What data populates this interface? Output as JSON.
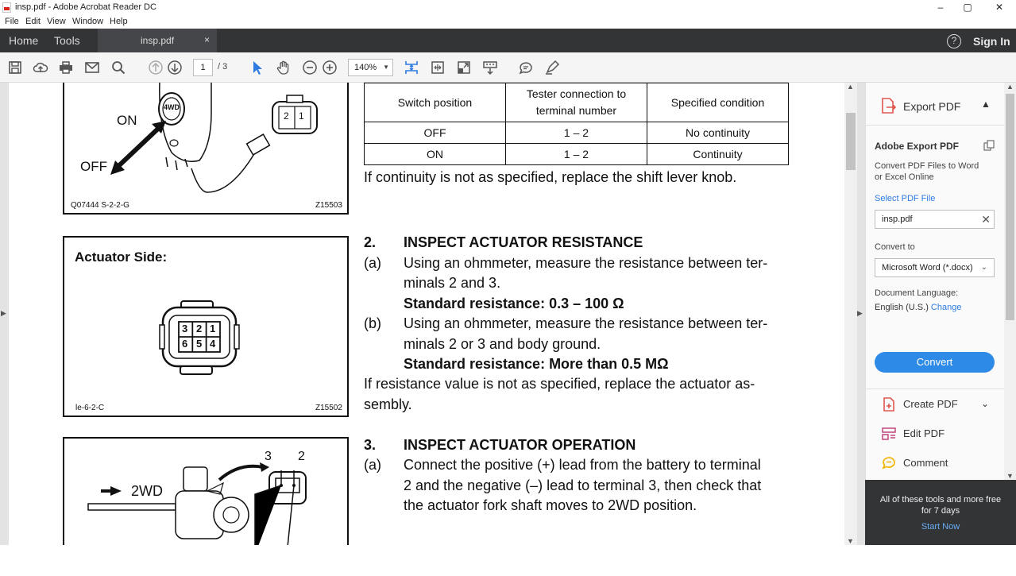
{
  "window": {
    "title": "insp.pdf - Adobe Acrobat Reader DC",
    "minimize": "–",
    "maximize": "▢",
    "close": "✕"
  },
  "menu": [
    "File",
    "Edit",
    "View",
    "Window",
    "Help"
  ],
  "tabs": {
    "home": "Home",
    "tools": "Tools",
    "document": "insp.pdf",
    "close": "×"
  },
  "header": {
    "help_glyph": "?",
    "sign_in": "Sign In"
  },
  "toolbar": {
    "current_page": "1",
    "total_pages": "/ 3",
    "zoom": "140%"
  },
  "document": {
    "table": {
      "headers": [
        "Switch position",
        "Tester connection to terminal number",
        "Specified condition"
      ],
      "rows": [
        [
          "OFF",
          "1 – 2",
          "No continuity"
        ],
        [
          "ON",
          "1 – 2",
          "Continuity"
        ]
      ]
    },
    "fig1": {
      "label_on": "ON",
      "label_off": "OFF",
      "knob": "4WD",
      "pin_2": "2",
      "pin_1": "1",
      "caption_left": "Q07444 S-2-2-G",
      "caption_right": "Z15503"
    },
    "fig2": {
      "title": "Actuator Side:",
      "pins": [
        "3",
        "2",
        "1",
        "6",
        "5",
        "4"
      ],
      "caption_left": "le-6-2-C",
      "caption_right": "Z15502"
    },
    "fig3": {
      "label": "2WD",
      "term_3": "3",
      "term_2": "2"
    },
    "continuity_note": "If continuity is not as specified, replace the shift lever knob.",
    "step2": {
      "number": "2.",
      "title": "INSPECT ACTUATOR RESISTANCE",
      "a_label": "(a)",
      "a_line1": "Using an ohmmeter, measure the resistance between ter-",
      "a_line2": "minals 2 and 3.",
      "a_std": "Standard resistance: 0.3 – 100 Ω",
      "b_label": "(b)",
      "b_line1": "Using an ohmmeter, measure the resistance between ter-",
      "b_line2": "minals 2 or 3 and body ground.",
      "b_std": "Standard resistance: More than 0.5 MΩ",
      "note_line1": "If resistance value is not as specified, replace the actuator as-",
      "note_line2": "sembly."
    },
    "step3": {
      "number": "3.",
      "title": "INSPECT ACTUATOR OPERATION",
      "a_label": "(a)",
      "a_line1": "Connect the positive (+) lead from the battery to terminal",
      "a_line2": "2 and the negative (–) lead to terminal 3, then check that",
      "a_line3": "the actuator fork shaft moves to 2WD position."
    }
  },
  "panel": {
    "export_pdf": "Export PDF",
    "title": "Adobe Export PDF",
    "description": "Convert PDF Files to Word or Excel Online",
    "select_file": "Select PDF File",
    "file_name": "insp.pdf",
    "convert_to_label": "Convert to",
    "format": "Microsoft Word (*.docx)",
    "language_label": "Document Language:",
    "language_value": "English (U.S.)",
    "language_change": "Change",
    "convert_button": "Convert",
    "tools": [
      "Create PDF",
      "Edit PDF",
      "Comment"
    ],
    "promo_text": "All of these tools and more free for 7 days",
    "promo_link": "Start Now"
  },
  "colors": {
    "accent_blue": "#2d8ae6",
    "link_blue": "#2d7be0",
    "dark_chrome": "#333436",
    "create_pdf_red": "#e0574f",
    "edit_pdf_pink": "#c2467a",
    "comment_yellow": "#f2b400"
  }
}
